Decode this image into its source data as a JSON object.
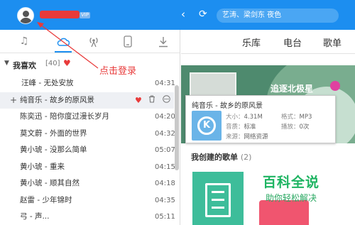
{
  "topbar": {
    "vip_badge": "VIP",
    "back_icon": "chevron-left-icon",
    "refresh_icon": "refresh-icon",
    "search_placeholder": "艺涛、梁剑东 夜色"
  },
  "left_tabs": [
    {
      "icon": "music-note-icon",
      "active": false
    },
    {
      "icon": "cloud-icon",
      "active": true
    },
    {
      "icon": "radio-broadcast-icon",
      "active": false
    },
    {
      "icon": "mobile-phone-icon",
      "active": false
    },
    {
      "icon": "download-icon",
      "active": false
    }
  ],
  "favorites": {
    "title": "我喜欢",
    "count": "[40]"
  },
  "songs": [
    {
      "title": "汪峰 - 无处安放",
      "duration": "04:31"
    },
    {
      "title": "纯音乐 - 故乡的原风景",
      "duration": ""
    },
    {
      "title": "陈奕迅 - 陪你度过漫长岁月",
      "duration": "04:20"
    },
    {
      "title": "莫文蔚 - 外面的世界",
      "duration": "04:32"
    },
    {
      "title": "黄小琥 - 没那么简单",
      "duration": "05:07"
    },
    {
      "title": "黄小琥 - 重来",
      "duration": "04:15"
    },
    {
      "title": "黄小琥 - 顺其自然",
      "duration": "04:18"
    },
    {
      "title": "赵雷 - 少年锦时",
      "duration": "04:35"
    },
    {
      "title": "弓 - 声...",
      "duration": "05:11"
    }
  ],
  "annotation": "点击登录",
  "right_nav": [
    "乐库",
    "电台",
    "歌单"
  ],
  "banner_title": "追逐北极星",
  "popup": {
    "title": "纯音乐 - 故乡的原风景",
    "size_label": "大小：",
    "size": "4.31M",
    "format_label": "格式：",
    "format": "MP3",
    "quality_label": "音质：",
    "quality": "标准",
    "plays_label": "播放：",
    "plays": "0次",
    "source_label": "来源：",
    "source": "网络资源"
  },
  "created_playlists": {
    "title": "我创建的歌单",
    "count": "(2)"
  },
  "watermark": {
    "line1": "百科全说",
    "line2": "助你轻松解决"
  },
  "colors": {
    "brand_blue": "#1c8ef0",
    "annotation_red": "#e83a3a",
    "watermark_green": "#1eb462"
  }
}
